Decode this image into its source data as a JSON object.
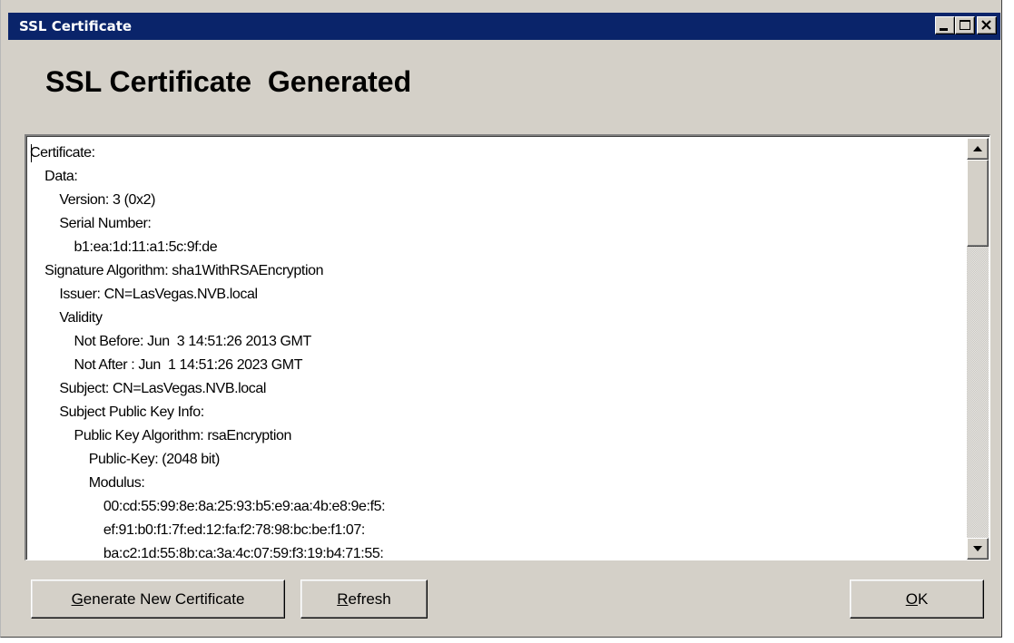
{
  "window": {
    "title": "SSL Certificate"
  },
  "heading": "SSL Certificate  Generated",
  "certificate_text": {
    "lines": [
      "Certificate:",
      "    Data:",
      "        Version: 3 (0x2)",
      "        Serial Number:",
      "            b1:ea:1d:11:a1:5c:9f:de",
      "    Signature Algorithm: sha1WithRSAEncryption",
      "        Issuer: CN=LasVegas.NVB.local",
      "        Validity",
      "            Not Before: Jun  3 14:51:26 2013 GMT",
      "            Not After : Jun  1 14:51:26 2023 GMT",
      "        Subject: CN=LasVegas.NVB.local",
      "        Subject Public Key Info:",
      "            Public Key Algorithm: rsaEncryption",
      "                Public-Key: (2048 bit)",
      "                Modulus:",
      "                    00:cd:55:99:8e:8a:25:93:b5:e9:aa:4b:e8:9e:f5:",
      "                    ef:91:b0:f1:7f:ed:12:fa:f2:78:98:bc:be:f1:07:",
      "                    ba:c2:1d:55:8b:ca:3a:4c:07:59:f3:19:b4:71:55:"
    ]
  },
  "buttons": {
    "generate": {
      "mnemonic": "G",
      "rest": "enerate New Certificate"
    },
    "refresh": {
      "mnemonic": "R",
      "rest": "efresh"
    },
    "ok": {
      "mnemonic": "O",
      "rest": "K"
    }
  },
  "colors": {
    "titlebar": "#0a246a",
    "face": "#d4d0c8"
  },
  "icons": {
    "minimize": "minimize-icon",
    "maximize": "maximize-icon",
    "close": "close-icon",
    "scroll_up": "arrow-up-icon",
    "scroll_down": "arrow-down-icon"
  }
}
